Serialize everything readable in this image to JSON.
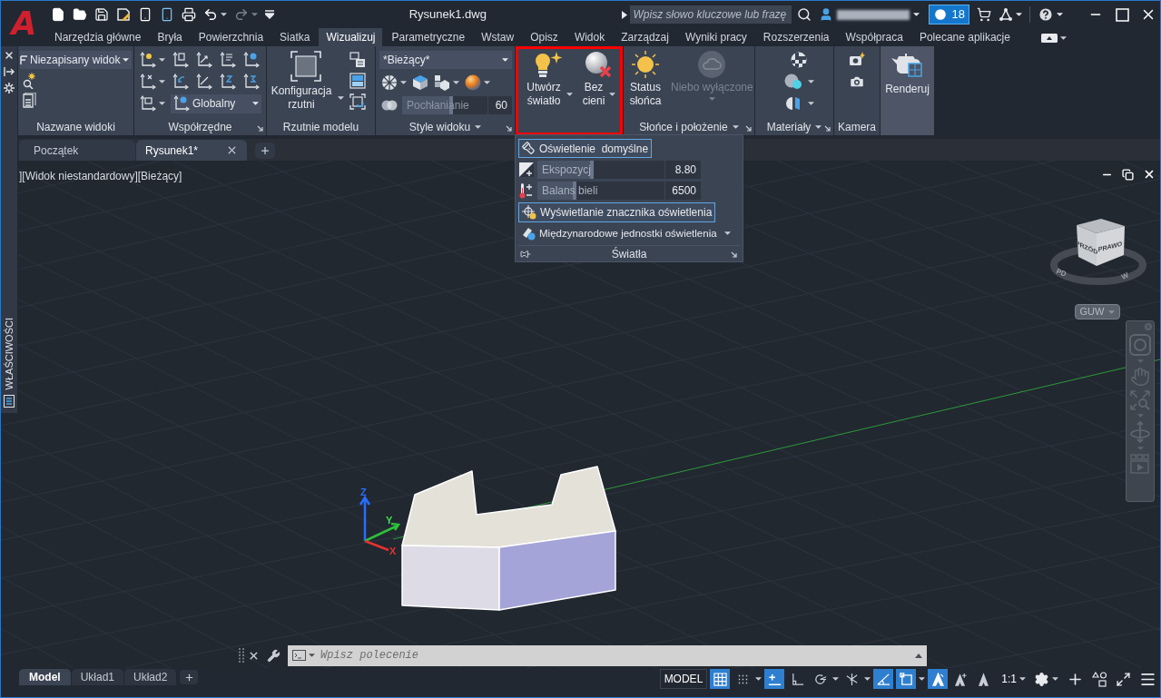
{
  "title_bar": {
    "logo": "A",
    "title": "Rysunek1.dwg",
    "search": {
      "placeholder": "Wpisz słowo kluczowe lub frazę"
    },
    "notifications": "18"
  },
  "ribbon_tabs": [
    {
      "label": "Narzędzia główne",
      "selected": false
    },
    {
      "label": "Bryła",
      "selected": false
    },
    {
      "label": "Powierzchnia",
      "selected": false
    },
    {
      "label": "Siatka",
      "selected": false
    },
    {
      "label": "Wizualizuj",
      "selected": true
    },
    {
      "label": "Parametryczne",
      "selected": false
    },
    {
      "label": "Wstaw",
      "selected": false
    },
    {
      "label": "Opisz",
      "selected": false
    },
    {
      "label": "Widok",
      "selected": false
    },
    {
      "label": "Zarządzaj",
      "selected": false
    },
    {
      "label": "Wyniki pracy",
      "selected": false
    },
    {
      "label": "Rozszerzenia",
      "selected": false
    },
    {
      "label": "Współpraca",
      "selected": false
    },
    {
      "label": "Polecane aplikacje",
      "selected": false
    }
  ],
  "ribbon": {
    "named_views": {
      "title": "Nazwane widoki",
      "view": "Niezapisany widok"
    },
    "coordinates": {
      "title": "Współrzędne",
      "ucs": "Globalny"
    },
    "model_viewports": {
      "title": "Rzutnie modelu",
      "button": "Konfiguracja rzutni"
    },
    "visual_styles": {
      "title": "Style widoku",
      "style": "*Bieżący*",
      "opacity": {
        "label": "Pochłanianie",
        "value": "60",
        "level": 0.6
      }
    },
    "lights": {
      "highlighted": true,
      "buttons": [
        "Utwórz światło",
        "Bez cieni"
      ]
    },
    "sun": {
      "title": "Słońce i położenie",
      "buttons": [
        {
          "label": "Status słońca",
          "disabled": false
        },
        {
          "label": "Niebo wyłączone",
          "disabled": true
        }
      ]
    },
    "materials": {
      "title": "Materiały"
    },
    "camera": {
      "title": "Kamera"
    },
    "render": {
      "button": "Renderuj"
    }
  },
  "lights_panel": {
    "title": "Światła",
    "default_lighting": {
      "label": "Oświetlenie  domyślne",
      "selected": true
    },
    "sliders": [
      {
        "label": "Ekspozycj",
        "value": "8.80",
        "level": 0.44
      },
      {
        "label": "Balans bieli",
        "value": "6500",
        "level": 0.31
      }
    ],
    "light_glyphs": {
      "label": "Wyświetlanie znacznika oświetlenia",
      "selected": true
    },
    "units": "Międzynarodowe jednostki oświetlenia"
  },
  "properties_palette": {
    "title": "WŁAŚCIWOŚCI"
  },
  "file_tabs": [
    {
      "label": "Początek",
      "selected": false
    },
    {
      "label": "Rysunek1*",
      "selected": true
    }
  ],
  "viewport": {
    "label": "][Widok niestandardowy][Bieżący]",
    "view_cube": {
      "faces": [
        "PRZÓD",
        "PRAWO"
      ],
      "compass": [
        "PD",
        "W"
      ]
    },
    "view_menu": "GUW",
    "ucs_axes": [
      "Z",
      "Y",
      "X"
    ]
  },
  "command_line": {
    "placeholder": "Wpisz polecenie"
  },
  "layout_tabs": [
    {
      "label": "Model",
      "selected": true
    },
    {
      "label": "Układ1",
      "selected": false
    },
    {
      "label": "Układ2",
      "selected": false
    }
  ],
  "status_bar": {
    "space": "MODEL",
    "toggles": [
      {
        "on": true
      },
      {
        "on": false
      },
      {
        "on": true
      },
      {
        "on": false
      },
      {
        "on": false
      },
      {
        "on": false
      },
      {
        "on": true
      },
      {
        "on": true
      },
      {
        "on": true
      },
      {
        "on": false
      },
      {
        "on": false
      }
    ],
    "scale": "1:1"
  }
}
